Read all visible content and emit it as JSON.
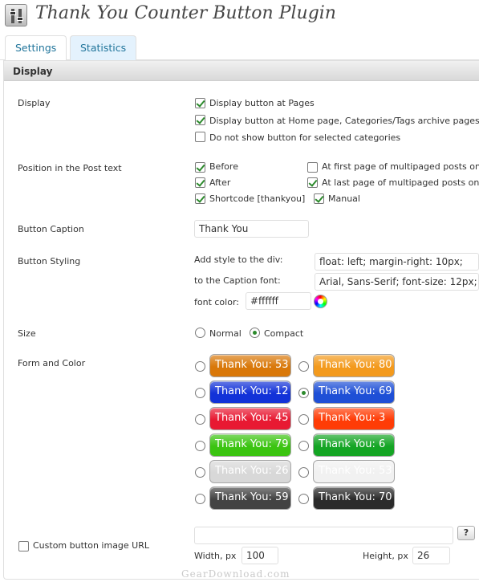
{
  "page": {
    "title": "Thank You Counter Button Plugin"
  },
  "tabs": [
    {
      "label": "Settings",
      "active": true
    },
    {
      "label": "Statistics",
      "active": false
    }
  ],
  "panel": {
    "title": "Display"
  },
  "display": {
    "label": "Display",
    "options": [
      {
        "label": "Display button at Pages",
        "checked": true
      },
      {
        "label": "Display button at Home page, Categories/Tags archive pages",
        "checked": true
      },
      {
        "label": "Do not show button for selected categories",
        "checked": false
      }
    ]
  },
  "position": {
    "label": "Position in the Post text",
    "before": {
      "label": "Before",
      "checked": true
    },
    "after": {
      "label": "After",
      "checked": true
    },
    "shortcode": {
      "label": "Shortcode [thankyou]",
      "checked": true
    },
    "manual": {
      "label": "Manual",
      "checked": true
    },
    "first_page": {
      "label": "At first page of multipaged posts only",
      "checked": false
    },
    "last_page": {
      "label": "At last page of multipaged posts only",
      "checked": true
    }
  },
  "caption": {
    "label": "Button Caption",
    "value": "Thank You"
  },
  "styling": {
    "label": "Button Styling",
    "div_label": "Add style to the div:",
    "div_value": "float: left; margin-right: 10px;",
    "font_label": "to the Caption font:",
    "font_value": "Arial, Sans-Serif; font-size: 12px;",
    "color_label": "font color:",
    "color_value": "#ffffff"
  },
  "size": {
    "label": "Size",
    "options": [
      {
        "label": "Normal",
        "checked": false
      },
      {
        "label": "Compact",
        "checked": true
      }
    ]
  },
  "form_color": {
    "label": "Form and Color",
    "buttons": [
      {
        "text": "Thank You: 53",
        "color": "#d9780a",
        "checked": false
      },
      {
        "text": "Thank You: 80",
        "color": "#f39a1d",
        "checked": false
      },
      {
        "text": "Thank You: 12",
        "color": "#1232d8",
        "checked": false
      },
      {
        "text": "Thank You: 69",
        "color": "#1e4fd6",
        "checked": true
      },
      {
        "text": "Thank You: 45",
        "color": "#e81932",
        "checked": false
      },
      {
        "text": "Thank You: 3",
        "color": "#ff3c06",
        "checked": false
      },
      {
        "text": "Thank You: 79",
        "color": "#3bc411",
        "checked": false
      },
      {
        "text": "Thank You: 6",
        "color": "#14a524",
        "checked": false
      },
      {
        "text": "Thank You: 26",
        "color": "#d8d8d8",
        "checked": false
      },
      {
        "text": "Thank You: 53",
        "color": "#f1f1f1",
        "checked": false
      },
      {
        "text": "Thank You: 59",
        "color": "#434343",
        "checked": false
      },
      {
        "text": "Thank You: 70",
        "color": "#2b2b2b",
        "checked": false
      }
    ]
  },
  "custom": {
    "label": "Custom button image URL",
    "checked": false,
    "url": "",
    "help": "?",
    "width_label": "Width, px",
    "width_value": "100",
    "height_label": "Height, px",
    "height_value": "26"
  },
  "watermark": "GearDownload.com"
}
